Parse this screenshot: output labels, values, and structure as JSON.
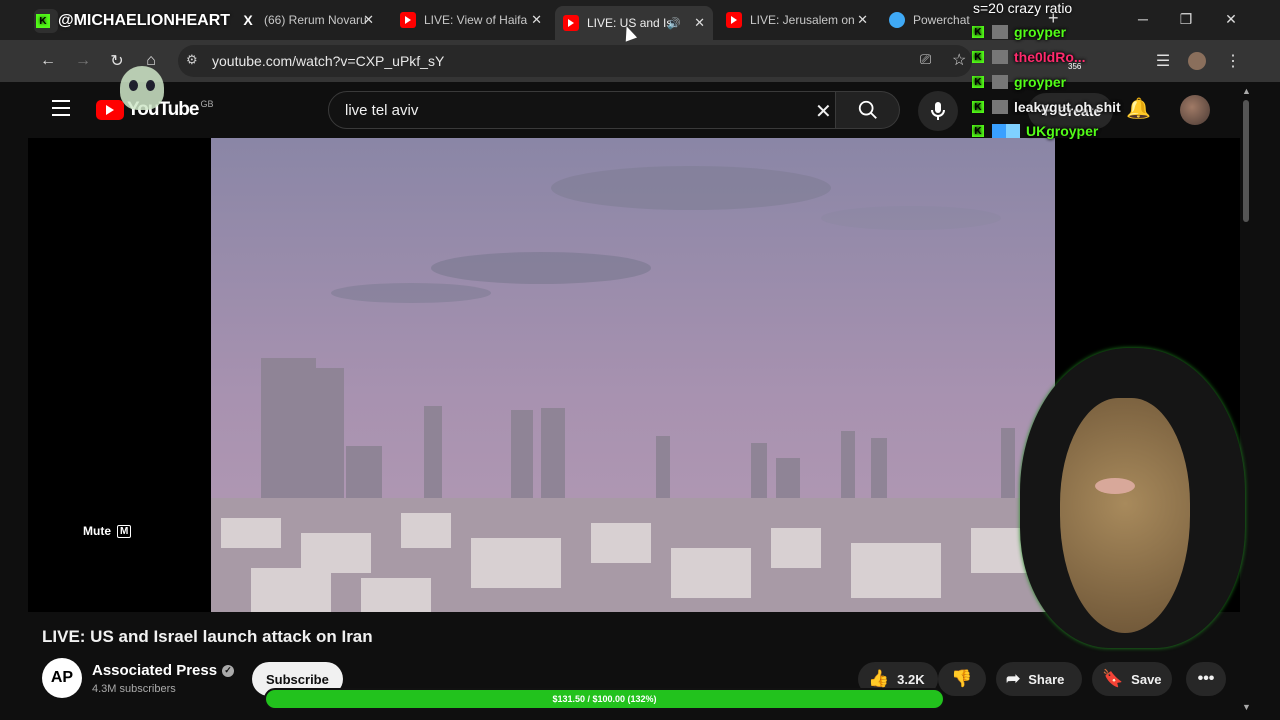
{
  "tabs": [
    {
      "label": "(66) Rerum Novaru",
      "icon": "x-logo-icon"
    },
    {
      "label": "LIVE: View of Haifa",
      "icon": "youtube-icon"
    },
    {
      "label": "LIVE: US and Is",
      "icon": "youtube-icon"
    },
    {
      "label": "LIVE: Jerusalem on",
      "icon": "youtube-icon"
    },
    {
      "label": "Powerchat",
      "icon": "powerchat-icon"
    }
  ],
  "address": {
    "url": "youtube.com/watch?v=CXP_uPkf_sY"
  },
  "youtube": {
    "logo": "YouTube",
    "region": "GB",
    "search_query": "live tel aviv",
    "create_label": "Create"
  },
  "video": {
    "mute_label": "Mute",
    "mute_key": "M",
    "title": "LIVE: US and Israel launch attack on Iran"
  },
  "channel": {
    "name": "Associated Press",
    "subscribers": "4.3M subscribers",
    "avatar_text": "AP",
    "subscribe_label": "Subscribe"
  },
  "actions": {
    "likes": "3.2K",
    "share_label": "Share",
    "save_label": "Save"
  },
  "overlay": {
    "streamer": "@MICHAELIONHEART",
    "ratio_text": "s=20 crazy ratio",
    "counter": "356",
    "chat": [
      {
        "user": "groyper",
        "color": "#53fc18"
      },
      {
        "user": "the0ldRo...",
        "color": "#ff2a6d"
      },
      {
        "user": "groyper",
        "color": "#53fc18"
      },
      {
        "user": "leakygut",
        "message": "oh shit",
        "color": "#f0f0f0"
      },
      {
        "user": "UKgroyper",
        "color": "#53fc18"
      }
    ],
    "goal_text": "$131.50 / $100.00 (132%)",
    "goal_progress": 1.0
  }
}
